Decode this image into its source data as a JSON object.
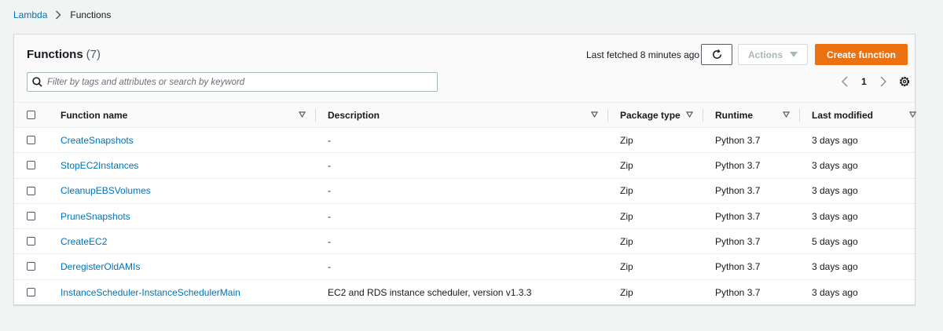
{
  "breadcrumb": {
    "root": "Lambda",
    "current": "Functions"
  },
  "panel": {
    "title": "Functions",
    "count": "(7)",
    "last_fetched": "Last fetched 8 minutes ago",
    "actions_label": "Actions",
    "create_label": "Create function",
    "search_placeholder": "Filter by tags and attributes or search by keyword",
    "search_value": "",
    "page_number": "1"
  },
  "colors": {
    "link": "#0073bb",
    "primary_button": "#ec7211",
    "page_bg": "#f2f3f3"
  },
  "table": {
    "columns": [
      "Function name",
      "Description",
      "Package type",
      "Runtime",
      "Last modified"
    ],
    "rows": [
      {
        "name": "CreateSnapshots",
        "description": "-",
        "package": "Zip",
        "runtime": "Python 3.7",
        "modified": "3 days ago"
      },
      {
        "name": "StopEC2Instances",
        "description": "-",
        "package": "Zip",
        "runtime": "Python 3.7",
        "modified": "3 days ago"
      },
      {
        "name": "CleanupEBSVolumes",
        "description": "-",
        "package": "Zip",
        "runtime": "Python 3.7",
        "modified": "3 days ago"
      },
      {
        "name": "PruneSnapshots",
        "description": "-",
        "package": "Zip",
        "runtime": "Python 3.7",
        "modified": "3 days ago"
      },
      {
        "name": "CreateEC2",
        "description": "-",
        "package": "Zip",
        "runtime": "Python 3.7",
        "modified": "5 days ago"
      },
      {
        "name": "DeregisterOldAMIs",
        "description": "-",
        "package": "Zip",
        "runtime": "Python 3.7",
        "modified": "3 days ago"
      },
      {
        "name": "InstanceScheduler-InstanceSchedulerMain",
        "description": "EC2 and RDS instance scheduler, version v1.3.3",
        "package": "Zip",
        "runtime": "Python 3.7",
        "modified": "3 days ago"
      }
    ]
  }
}
